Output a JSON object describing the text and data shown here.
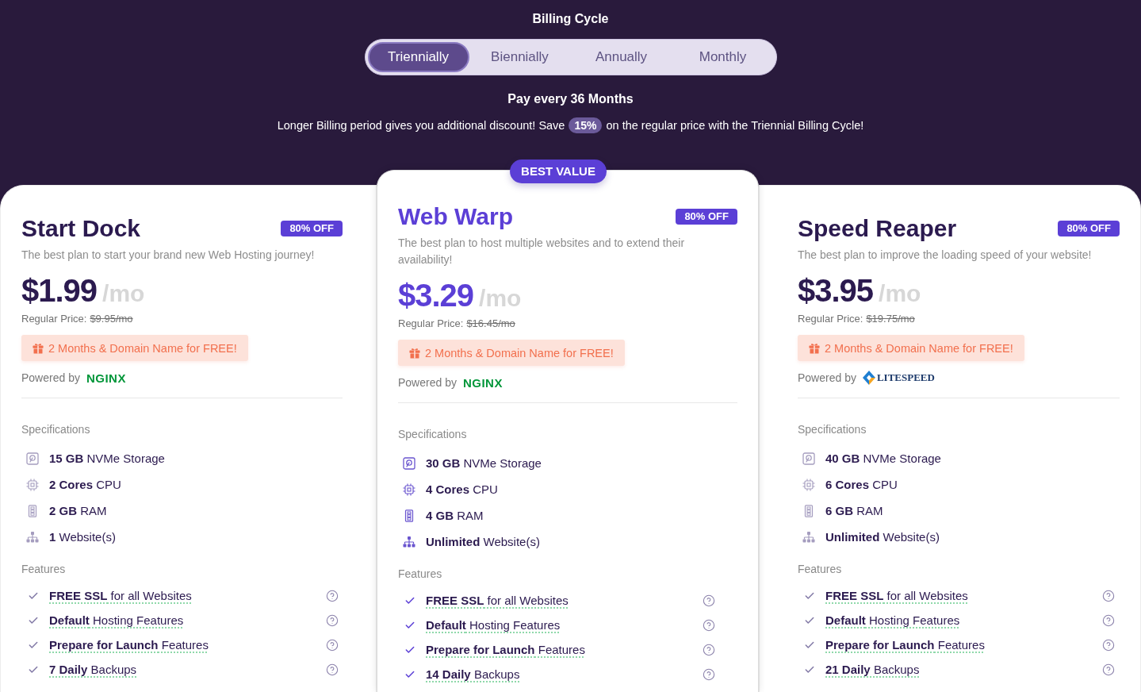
{
  "billing": {
    "title": "Billing Cycle",
    "tabs": [
      {
        "label": "Triennially",
        "selected": true
      },
      {
        "label": "Biennially",
        "selected": false
      },
      {
        "label": "Annually",
        "selected": false
      },
      {
        "label": "Monthly",
        "selected": false
      }
    ],
    "period": "Pay every 36 Months",
    "discount_note": {
      "before": "Longer Billing period gives you additional discount! Save",
      "badge": "15%",
      "after": "on the regular price with the Triennial Billing Cycle!"
    }
  },
  "plans": [
    {
      "name": "Start Dock",
      "featured": false,
      "discount": "80% OFF",
      "description": "The best plan to start your brand new Web Hosting journey!",
      "price": "$1.99",
      "unit": "/mo",
      "regular_price": {
        "label": "Regular Price:",
        "amount": "$9.95/mo"
      },
      "promo": "2 Months & Domain Name for FREE!",
      "powered_by": {
        "label": "Powered by",
        "kind": "nginx",
        "logo": "NGINX"
      },
      "specs_title": "Specifications",
      "specs": [
        {
          "kind": "storage",
          "text": "**15 GB** NVMe Storage"
        },
        {
          "kind": "cpu",
          "text": "**2 Cores** CPU"
        },
        {
          "kind": "ram",
          "text": "**2 GB** RAM"
        },
        {
          "kind": "websites",
          "text": "**1** Website(s)"
        }
      ],
      "features_title": "Features",
      "features": [
        "**FREE SSL** for all Websites",
        "**Default** Hosting Features",
        "**Prepare for Launch** Features",
        "**7 Daily** Backups"
      ]
    },
    {
      "name": "Web Warp",
      "featured": true,
      "ribbon": "BEST VALUE",
      "discount": "80% OFF",
      "description": "The best plan to host multiple websites and to extend their availability!",
      "price": "$3.29",
      "unit": "/mo",
      "regular_price": {
        "label": "Regular Price:",
        "amount": "$16.45/mo"
      },
      "promo": "2 Months & Domain Name for FREE!",
      "powered_by": {
        "label": "Powered by",
        "kind": "nginx",
        "logo": "NGINX"
      },
      "specs_title": "Specifications",
      "specs": [
        {
          "kind": "storage",
          "text": "**30 GB** NVMe Storage"
        },
        {
          "kind": "cpu",
          "text": "**4 Cores** CPU"
        },
        {
          "kind": "ram",
          "text": "**4 GB** RAM"
        },
        {
          "kind": "websites",
          "text": "**Unlimited** Website(s)"
        }
      ],
      "features_title": "Features",
      "features": [
        "**FREE SSL** for all Websites",
        "**Default** Hosting Features",
        "**Prepare for Launch** Features",
        "**14 Daily** Backups"
      ]
    },
    {
      "name": "Speed Reaper",
      "featured": false,
      "discount": "80% OFF",
      "description": "The best plan to improve the loading speed of your website!",
      "price": "$3.95",
      "unit": "/mo",
      "regular_price": {
        "label": "Regular Price:",
        "amount": "$19.75/mo"
      },
      "promo": "2 Months & Domain Name for FREE!",
      "powered_by": {
        "label": "Powered by",
        "kind": "litespeed",
        "logo": "LITESPEED"
      },
      "specs_title": "Specifications",
      "specs": [
        {
          "kind": "storage",
          "text": "**40 GB** NVMe Storage"
        },
        {
          "kind": "cpu",
          "text": "**6 Cores** CPU"
        },
        {
          "kind": "ram",
          "text": "**6 GB** RAM"
        },
        {
          "kind": "websites",
          "text": "**Unlimited** Website(s)"
        }
      ],
      "features_title": "Features",
      "features": [
        "**FREE SSL** for all Websites",
        "**Default** Hosting Features",
        "**Prepare for Launch** Features",
        "**21 Daily** Backups"
      ]
    }
  ]
}
